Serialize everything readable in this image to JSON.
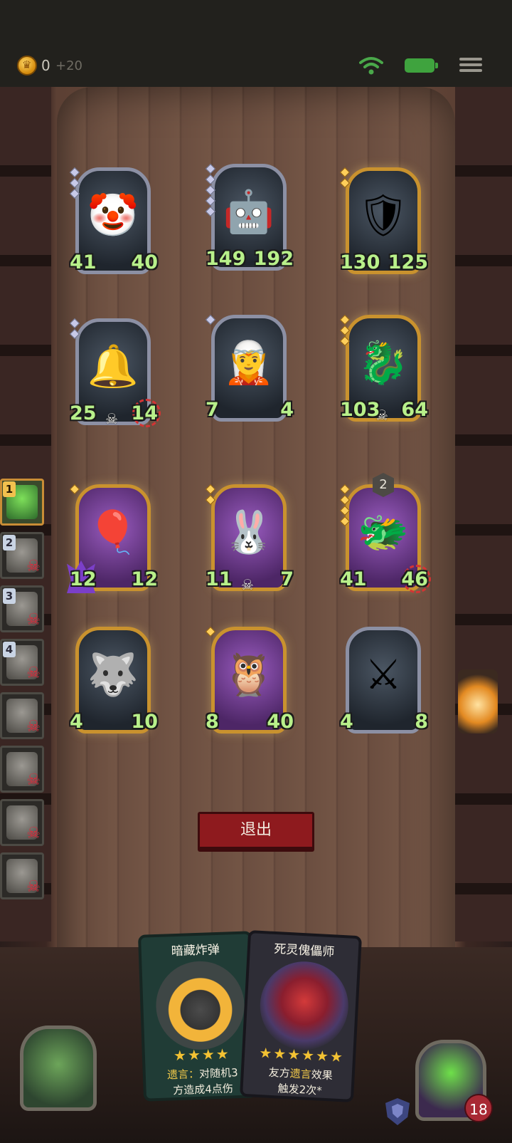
{
  "topbar": {
    "coins": "0",
    "coin_bonus": "+20",
    "icons": [
      "coin-icon",
      "wifi-icon",
      "battery-icon",
      "menu-icon"
    ]
  },
  "board": {
    "units": [
      {
        "name": "clown",
        "attack": "41",
        "health": "40",
        "frame": "silver",
        "glyph": "🤡",
        "gems": 3
      },
      {
        "name": "golden-automaton",
        "attack": "149",
        "health": "192",
        "frame": "silver",
        "glyph": "🤖",
        "gems": 5
      },
      {
        "name": "golden-knight",
        "attack": "130",
        "health": "125",
        "frame": "gold",
        "glyph": "🛡",
        "gems": 2
      },
      {
        "name": "bell-robot",
        "attack": "25",
        "health": "14",
        "frame": "silver",
        "glyph": "🔔",
        "gems": 2,
        "skull": true,
        "fire": true
      },
      {
        "name": "elf-sorceress",
        "attack": "7",
        "health": "4",
        "frame": "silver",
        "glyph": "🧝",
        "gems": 1
      },
      {
        "name": "bone-dragon",
        "attack": "103",
        "health": "64",
        "frame": "gold",
        "glyph": "🐉",
        "gems": 3,
        "skull": true
      },
      {
        "name": "zeppelin",
        "attack": "12",
        "health": "12",
        "frame": "gold",
        "glyph": "🎈",
        "gems": 1,
        "purple": true,
        "flame": true
      },
      {
        "name": "rabbit-robot",
        "attack": "11",
        "health": "7",
        "frame": "gold",
        "glyph": "🐰",
        "gems": 2,
        "purple": true,
        "skull": true
      },
      {
        "name": "dragon-imp",
        "attack": "41",
        "health": "46",
        "frame": "gold",
        "glyph": "🐲",
        "gems": 4,
        "purple": true,
        "fire": true,
        "level": "2"
      },
      {
        "name": "hyena",
        "attack": "4",
        "health": "10",
        "frame": "gold",
        "glyph": "🐺",
        "gems": 0
      },
      {
        "name": "owl-beast",
        "attack": "8",
        "health": "40",
        "frame": "gold",
        "glyph": "🦉",
        "gems": 1,
        "purple": true
      },
      {
        "name": "armored-shadow",
        "attack": "4",
        "health": "8",
        "frame": "silver",
        "glyph": "⚔",
        "gems": 0
      }
    ]
  },
  "turn_order": [
    {
      "num": "1",
      "active": true,
      "dead": false
    },
    {
      "num": "2",
      "active": false,
      "dead": true
    },
    {
      "num": "3",
      "active": false,
      "dead": true
    },
    {
      "num": "4",
      "active": false,
      "dead": true
    },
    {
      "num": "",
      "active": false,
      "dead": true
    },
    {
      "num": "",
      "active": false,
      "dead": true
    },
    {
      "num": "",
      "active": false,
      "dead": true
    },
    {
      "num": "",
      "active": false,
      "dead": true
    }
  ],
  "exit_label": "退出",
  "hand": [
    {
      "title": "暗藏炸弹",
      "stars": "★★★★",
      "keyword": "遗言：",
      "line1": "对随机3",
      "line2": "方造成4点伤"
    },
    {
      "title": "死灵傀儡师",
      "stars": "★★★★★★",
      "pre": "友方",
      "keyword": "遗言",
      "post": "效果",
      "line2": "触发2次*"
    }
  ],
  "hero": {
    "health": "18"
  },
  "colors": {
    "accent_gold": "#c9922e",
    "hp_red": "#9e2a2a",
    "stat_green": "#b8f08a",
    "exit_red": "#8e1a1e"
  }
}
